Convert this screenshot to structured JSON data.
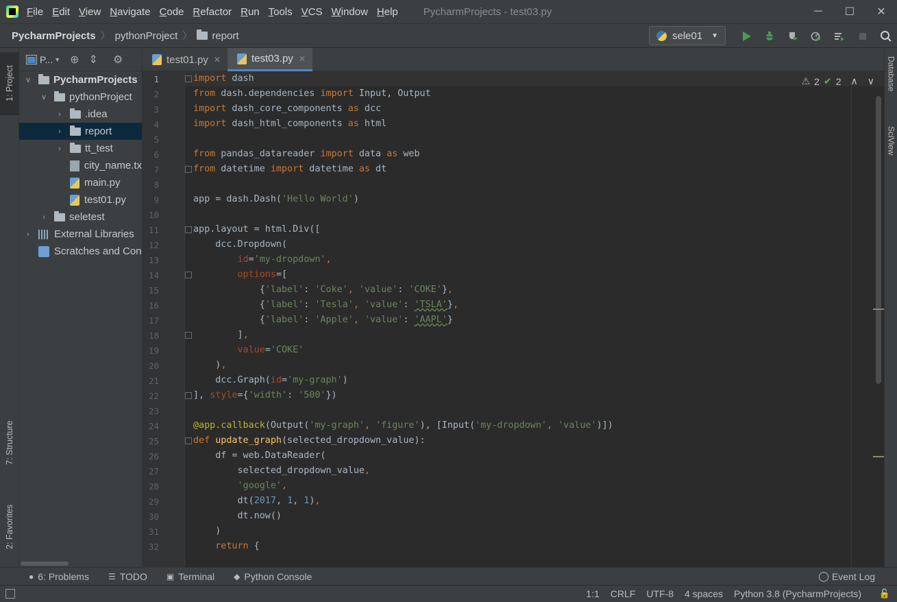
{
  "window": {
    "title": "PycharmProjects - test03.py",
    "menu": [
      "File",
      "Edit",
      "View",
      "Navigate",
      "Code",
      "Refactor",
      "Run",
      "Tools",
      "VCS",
      "Window",
      "Help"
    ],
    "controls": {
      "minimize": "─",
      "maximize": "☐",
      "close": "✕"
    }
  },
  "navbar": {
    "breadcrumbs": [
      "PycharmProjects",
      "pythonProject",
      "report"
    ],
    "run_config": "sele01",
    "tools": [
      "run-icon",
      "debug-icon",
      "coverage-icon",
      "profile-icon",
      "build-icon",
      "stop-icon",
      "search-icon"
    ]
  },
  "left_strip": {
    "project_tab": "1: Project",
    "structure_tab": "7: Structure",
    "favorites_tab": "2: Favorites"
  },
  "project_panel": {
    "title": "P...",
    "tree": [
      {
        "label": "PycharmProjects",
        "type": "folder",
        "depth": 0,
        "expanded": true,
        "bold": true
      },
      {
        "label": "pythonProject",
        "type": "folder",
        "depth": 1,
        "expanded": true
      },
      {
        "label": ".idea",
        "type": "folder",
        "depth": 2,
        "expanded": false
      },
      {
        "label": "report",
        "type": "folder",
        "depth": 2,
        "expanded": false,
        "selected": true
      },
      {
        "label": "tt_test",
        "type": "folder",
        "depth": 2,
        "expanded": false
      },
      {
        "label": "city_name.tx",
        "type": "text",
        "depth": 2
      },
      {
        "label": "main.py",
        "type": "python",
        "depth": 2
      },
      {
        "label": "test01.py",
        "type": "python",
        "depth": 2
      },
      {
        "label": "seletest",
        "type": "folder",
        "depth": 1,
        "expanded": false
      },
      {
        "label": "External Libraries",
        "type": "library",
        "depth": 0,
        "expanded": false
      },
      {
        "label": "Scratches and Con",
        "type": "scratch",
        "depth": 0
      }
    ]
  },
  "editor": {
    "tabs": [
      {
        "label": "test01.py",
        "active": false
      },
      {
        "label": "test03.py",
        "active": true
      }
    ],
    "inspection": {
      "warnings": "2",
      "ok": "2"
    },
    "current_line": 1,
    "lines": [
      "import dash",
      "from dash.dependencies import Input, Output",
      "import dash_core_components as dcc",
      "import dash_html_components as html",
      "",
      "from pandas_datareader import data as web",
      "from datetime import datetime as dt",
      "",
      "app = dash.Dash('Hello World')",
      "",
      "app.layout = html.Div([",
      "    dcc.Dropdown(",
      "        id='my-dropdown',",
      "        options=[",
      "            {'label': 'Coke', 'value': 'COKE'},",
      "            {'label': 'Tesla', 'value': 'TSLA'},",
      "            {'label': 'Apple', 'value': 'AAPL'}",
      "        ],",
      "        value='COKE'",
      "    ),",
      "    dcc.Graph(id='my-graph')",
      "], style={'width': '500'})",
      "",
      "@app.callback(Output('my-graph', 'figure'), [Input('my-dropdown', 'value')])",
      "def update_graph(selected_dropdown_value):",
      "    df = web.DataReader(",
      "        selected_dropdown_value,",
      "        'google',",
      "        dt(2017, 1, 1),",
      "        dt.now()",
      "    )",
      "    return {"
    ]
  },
  "right_strip": {
    "tabs": [
      "Database",
      "SciView"
    ]
  },
  "bottom_bar": {
    "tabs": [
      "6: Problems",
      "TODO",
      "Terminal",
      "Python Console"
    ],
    "event_log": "Event Log"
  },
  "status_bar": {
    "position": "1:1",
    "line_separator": "CRLF",
    "encoding": "UTF-8",
    "indent": "4 spaces",
    "interpreter": "Python 3.8 (PycharmProjects)"
  },
  "colors": {
    "keyword": "#cc7832",
    "string": "#6a8759",
    "number": "#6897bb",
    "parameter": "#aa4926",
    "decorator": "#bbb529",
    "function_name": "#ffc66d",
    "default_text": "#a9b7c6",
    "selection": "#0d293e",
    "run_green": "#499c54"
  }
}
